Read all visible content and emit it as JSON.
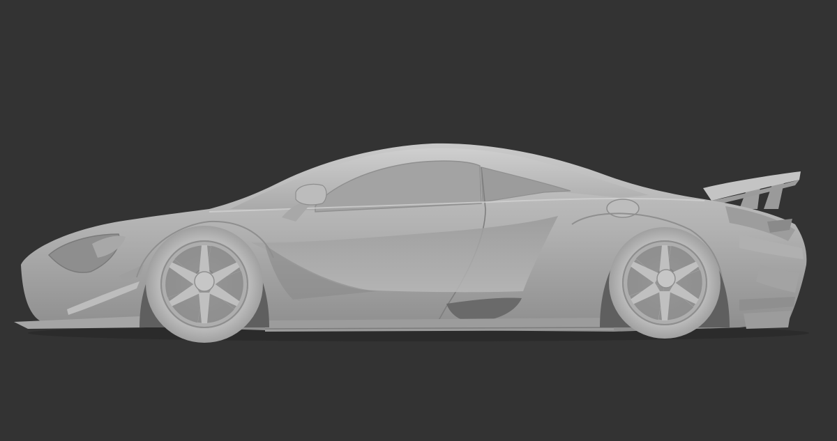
{
  "viewport": {
    "background_color": "#333333"
  },
  "model": {
    "subject": "race-car-side-profile",
    "material_color": "#a8a8a8",
    "highlight_color": "#cfcfcf",
    "shadow_color": "#7a7a7a",
    "dark_recess_color": "#5c5c5c"
  }
}
